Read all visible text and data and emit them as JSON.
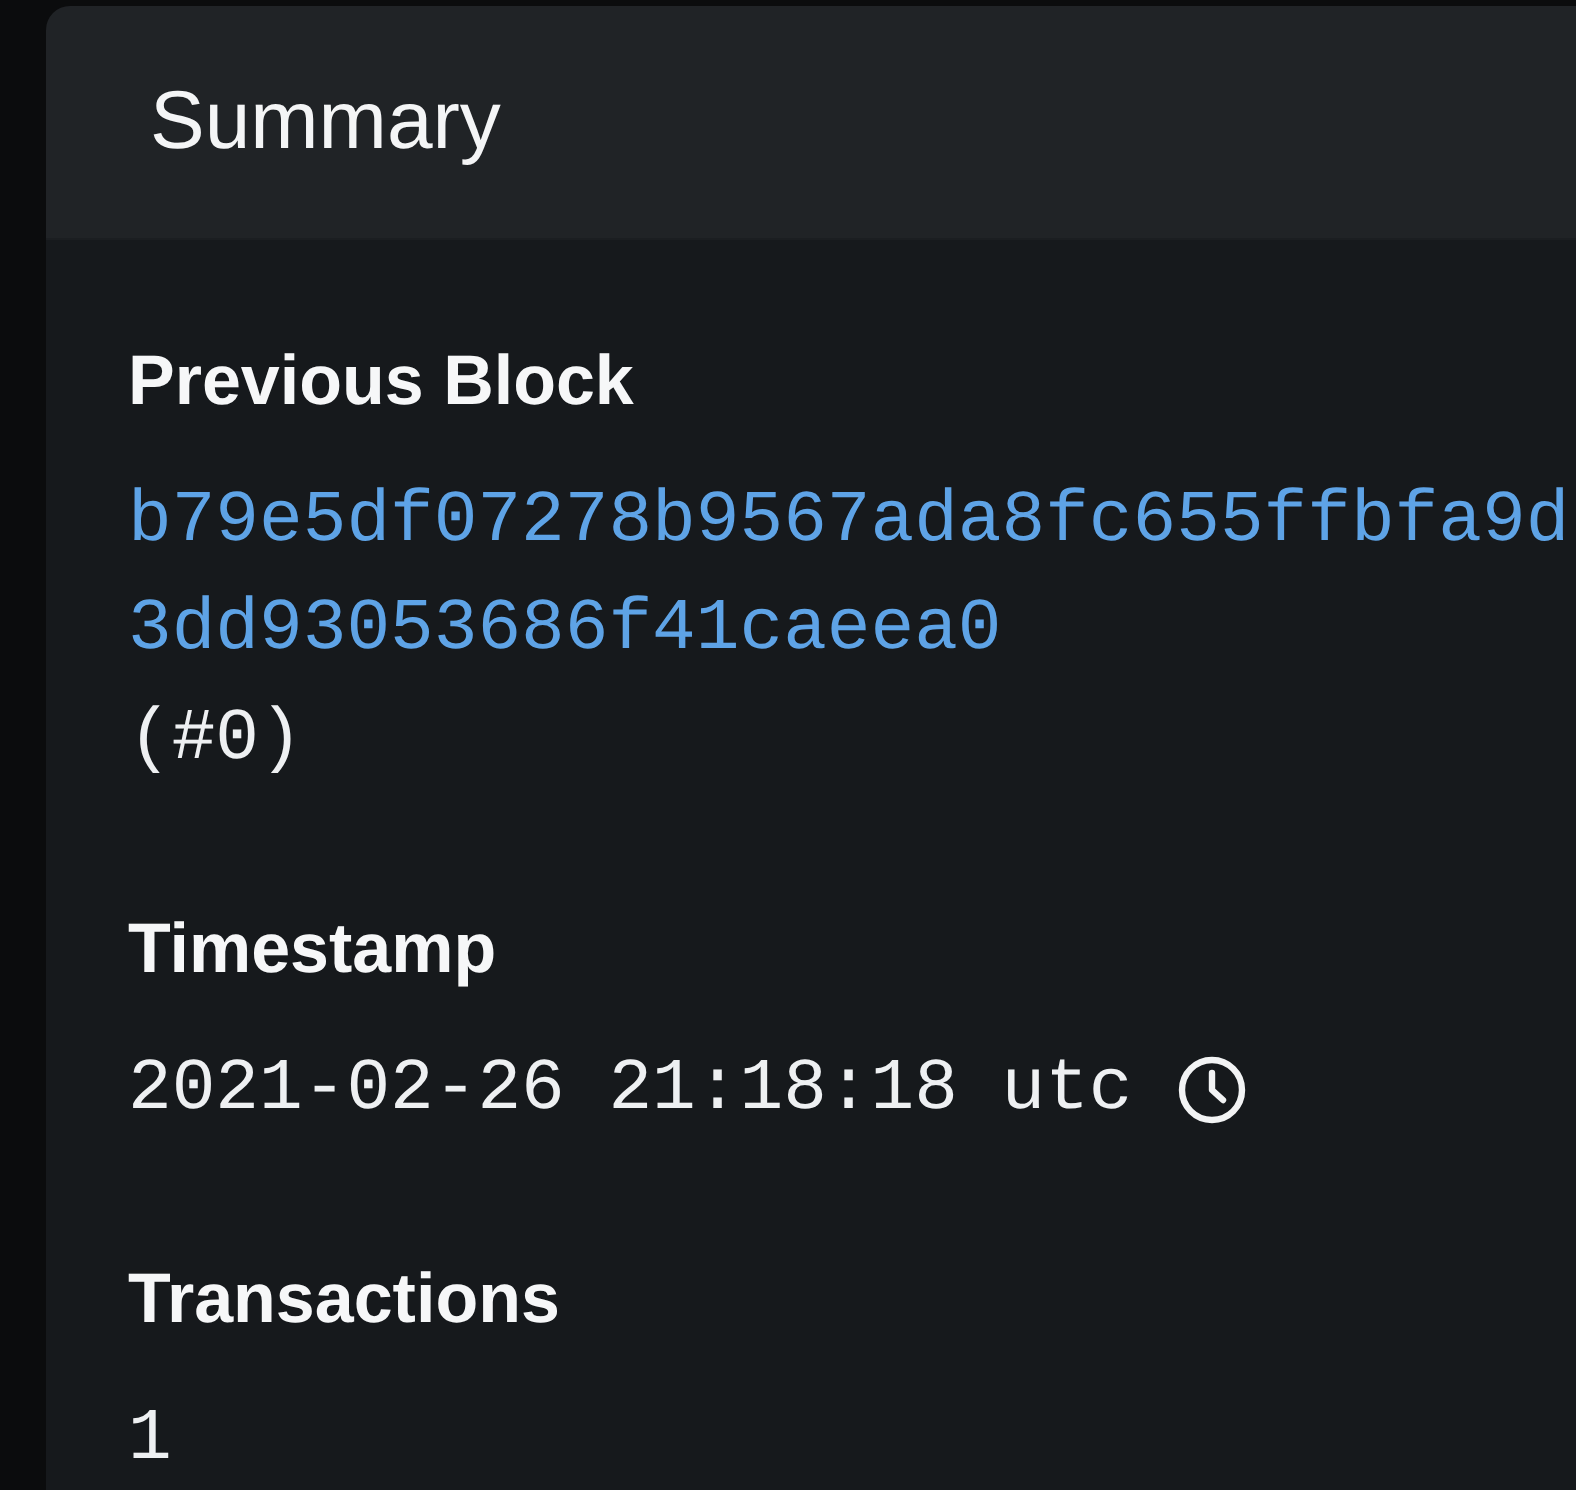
{
  "card": {
    "title": "Summary"
  },
  "fields": [
    {
      "kind": "link",
      "label": "Previous Block",
      "value": "b79e5df07278b9567ada8fc655ffbfa9d3dd93053686f41caeea0",
      "note": "(#0)"
    },
    {
      "kind": "time",
      "label": "Timestamp",
      "value": "2021-02-26 21:18:18 utc"
    },
    {
      "kind": "text",
      "label": "Transactions",
      "value": "1"
    }
  ]
}
